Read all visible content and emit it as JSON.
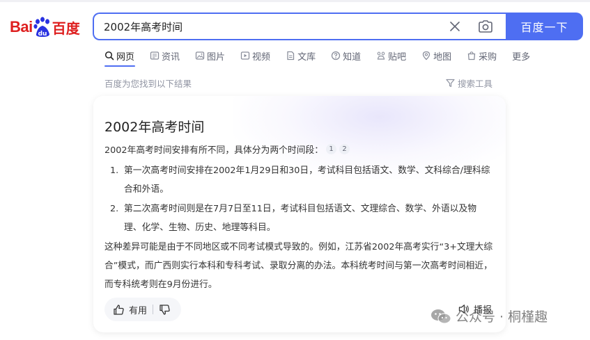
{
  "logo": {
    "bai": "Bai",
    "du": "百度"
  },
  "search": {
    "query": "2002年高考时间",
    "button_label": "百度一下"
  },
  "tabs": [
    {
      "label": "网页",
      "icon": "search-icon"
    },
    {
      "label": "资讯",
      "icon": "news-icon"
    },
    {
      "label": "图片",
      "icon": "image-icon"
    },
    {
      "label": "视频",
      "icon": "video-icon"
    },
    {
      "label": "文库",
      "icon": "document-icon"
    },
    {
      "label": "知道",
      "icon": "question-icon"
    },
    {
      "label": "贴吧",
      "icon": "tieba-icon"
    },
    {
      "label": "地图",
      "icon": "map-icon"
    },
    {
      "label": "采购",
      "icon": "shopping-icon"
    },
    {
      "label": "更多",
      "icon": ""
    }
  ],
  "result_hint": "百度为您找到以下结果",
  "tools_label": "搜索工具",
  "card": {
    "title": "2002年高考时间",
    "intro": "2002年高考时间安排有所不同，具体分为两个时间段：",
    "citations": [
      "1",
      "2"
    ],
    "items": [
      {
        "num": "1.",
        "text": "第一次高考时间安排在2002年1月29日和30日，考试科目包括语文、数学、文科综合/理科综合和外语。"
      },
      {
        "num": "2.",
        "text": "第二次高考时间则是在7月7日至11日，考试科目包括语文、文理综合、数学、外语以及物理、化学、生物、历史、地理等科目。"
      }
    ],
    "paragraph": "这种差异可能是由于不同地区或不同考试模式导致的。例如，江苏省2002年高考实行“3+文理大综合”模式，而广西则实行本科和专科考试、录取分离的办法。本科统考时间与第一次高考时间相近，而专科统考则在9月份进行。",
    "useful_label": "有用",
    "play_label": "播报"
  },
  "watermark": "公众号 · 桐槿趣",
  "colors": {
    "accent": "#4e6ef2",
    "logo_red": "#de1f1f",
    "logo_blue": "#2932e1"
  }
}
